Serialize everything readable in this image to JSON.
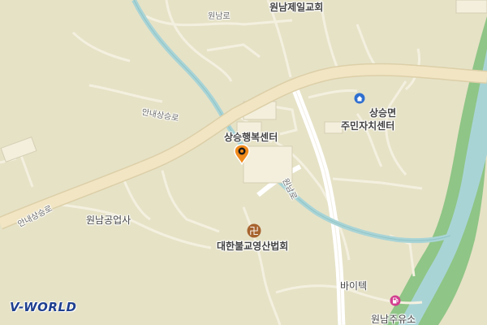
{
  "map": {
    "labels": {
      "wonnam_jeil_church": "원남제일교회",
      "wonnam_ro": "원남로",
      "annae_sangseung_ro_upper": "안내상승로",
      "annae_sangseung_ro_lower": "안내상승로",
      "sangseung_happiness_center": "상승행복센터",
      "sangseung_myeon_line1": "상승면",
      "sangseung_myeon_line2": "주민자치센터",
      "road_vertical": "원남로",
      "wonnam_gongupsa": "원남공업사",
      "daehan_temple": "대한불교영산법회",
      "biotech": "바이텍",
      "wonnam_gas_station": "원남주유소"
    },
    "icons": {
      "selected_marker": "location-pin-icon",
      "office": "government-office-icon",
      "temple": "buddhist-temple-icon",
      "gas_station": "gas-station-icon"
    },
    "colors": {
      "background": "#e6e2c6",
      "major_road": "#f1e5c3",
      "river": "#a9d4d6",
      "river_bank": "#6fb47f",
      "marker": "#f08a1c",
      "logo": "#1f3f8f"
    }
  },
  "branding": {
    "logo_text": "V-WORLD"
  }
}
